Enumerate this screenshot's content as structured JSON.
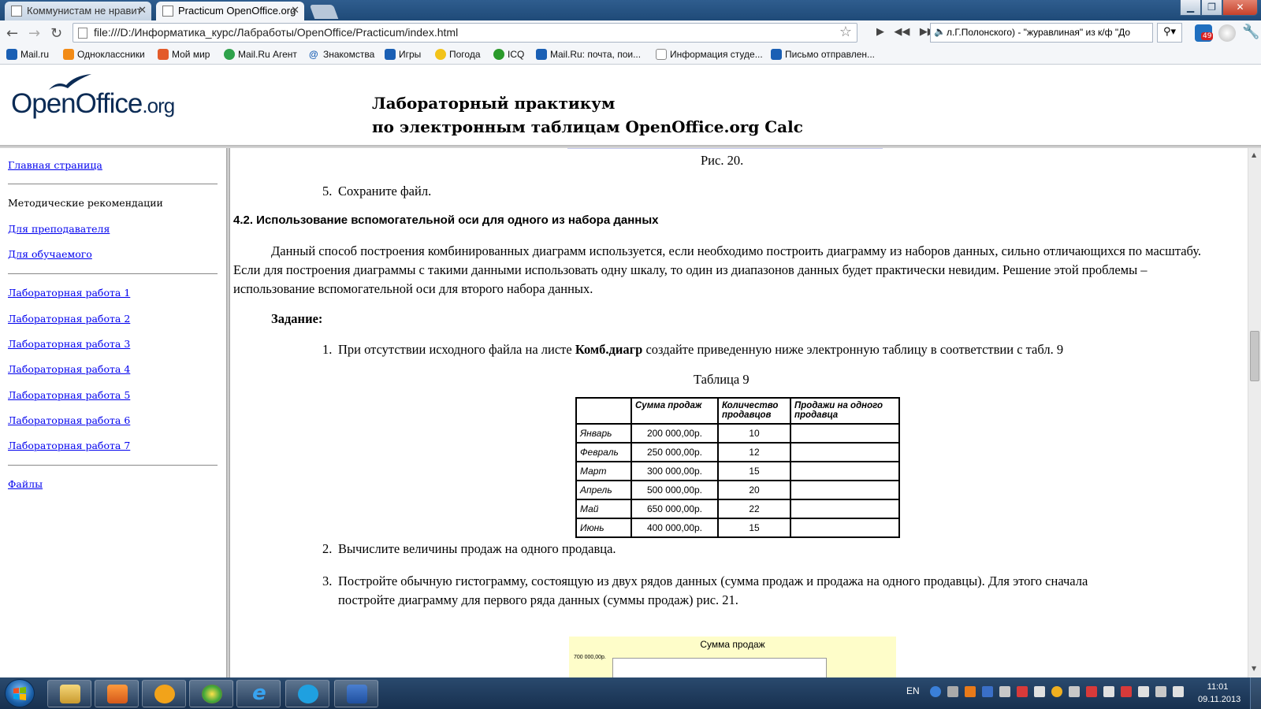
{
  "browser": {
    "tabs": [
      {
        "label": "Коммунистам не нравит"
      },
      {
        "label": "Practicum OpenOffice.org"
      }
    ],
    "address": "file:///D:/Информатика_курс/Лабработы/OpenOffice/Practicum/index.html",
    "radio_text": "л.Г.Полонского) - \"журавлиная\" из к/ф \"До",
    "bookmarks": [
      "Mail.ru",
      "Одноклассники",
      "Мой мир",
      "Mail.Ru Агент",
      "Знакомства",
      "Игры",
      "Погода",
      "ICQ",
      "Mail.Ru: почта, пои...",
      "Информация студе...",
      "Письмо отправлен..."
    ],
    "badge_count": "49"
  },
  "header": {
    "logo_main": "OpenOffice",
    "logo_org": ".org",
    "title_line1": "Лабораторный практикум",
    "title_line2": "по электронным таблицам OpenOffice.org Calc"
  },
  "sidebar": {
    "home": "Главная страница",
    "methods": "Методические рекомендации",
    "for_teacher": "Для преподавателя",
    "for_student": "Для обучаемого",
    "labs": [
      "Лабораторная работа 1",
      "Лабораторная работа 2",
      "Лабораторная работа 3",
      "Лабораторная работа 4",
      "Лабораторная работа 5",
      "Лабораторная работа 6",
      "Лабораторная работа 7"
    ],
    "files": "Файлы"
  },
  "content": {
    "fig_caption": "Рис. 20.",
    "step5_num": "5.",
    "step5": "Сохраните файл.",
    "section_title": "4.2. Использование вспомогательной оси для одного из набора данных",
    "paragraph": "Данный способ построения комбинированных диаграмм используется, если необходимо построить диаграмму из наборов данных, сильно отличающихся по масштабу. Если для построения диаграммы с такими данными использовать одну шкалу, то один из диапазонов данных будет практически невидим. Решение этой проблемы – использование вспомогательной оси для второго набора данных.",
    "task_label": "Задание:",
    "item1_num": "1.",
    "item1_a": "При отсутствии исходного файла на листе ",
    "item1_bold": "Комб.диагр",
    "item1_b": " создайте приведенную ниже электронную таблицу в соответствии с табл. 9",
    "table_caption": "Таблица 9",
    "table": {
      "headers": [
        "",
        "Сумма продаж",
        "Количество продавцов",
        "Продажи на одного продавца"
      ],
      "rows": [
        [
          "Январь",
          "200 000,00р.",
          "10",
          ""
        ],
        [
          "Февраль",
          "250 000,00р.",
          "12",
          ""
        ],
        [
          "Март",
          "300 000,00р.",
          "15",
          ""
        ],
        [
          "Апрель",
          "500 000,00р.",
          "20",
          ""
        ],
        [
          "Май",
          "650 000,00р.",
          "22",
          ""
        ],
        [
          "Июнь",
          "400 000,00р.",
          "15",
          ""
        ]
      ]
    },
    "item2_num": "2.",
    "item2": "Вычислите величины продаж на одного продавца.",
    "item3_num": "3.",
    "item3_line1": "Постройте обычную гистограмму, состоящую из двух рядов данных (сумма продаж и продажа на одного продавцы). Для этого сначала",
    "item3_line2": "постройте диаграмму для первого ряда данных (суммы продаж) рис. 21.",
    "chart_title": "Сумма продаж",
    "chart_tick": "700 000,00р."
  },
  "taskbar": {
    "lang": "EN",
    "time": "11:01",
    "date": "09.11.2013"
  },
  "colors": {
    "link": "#0000ee",
    "titlebar": "#2f5d8e",
    "taskbar": "#17304f",
    "chart_bg": "#fefdc9"
  }
}
